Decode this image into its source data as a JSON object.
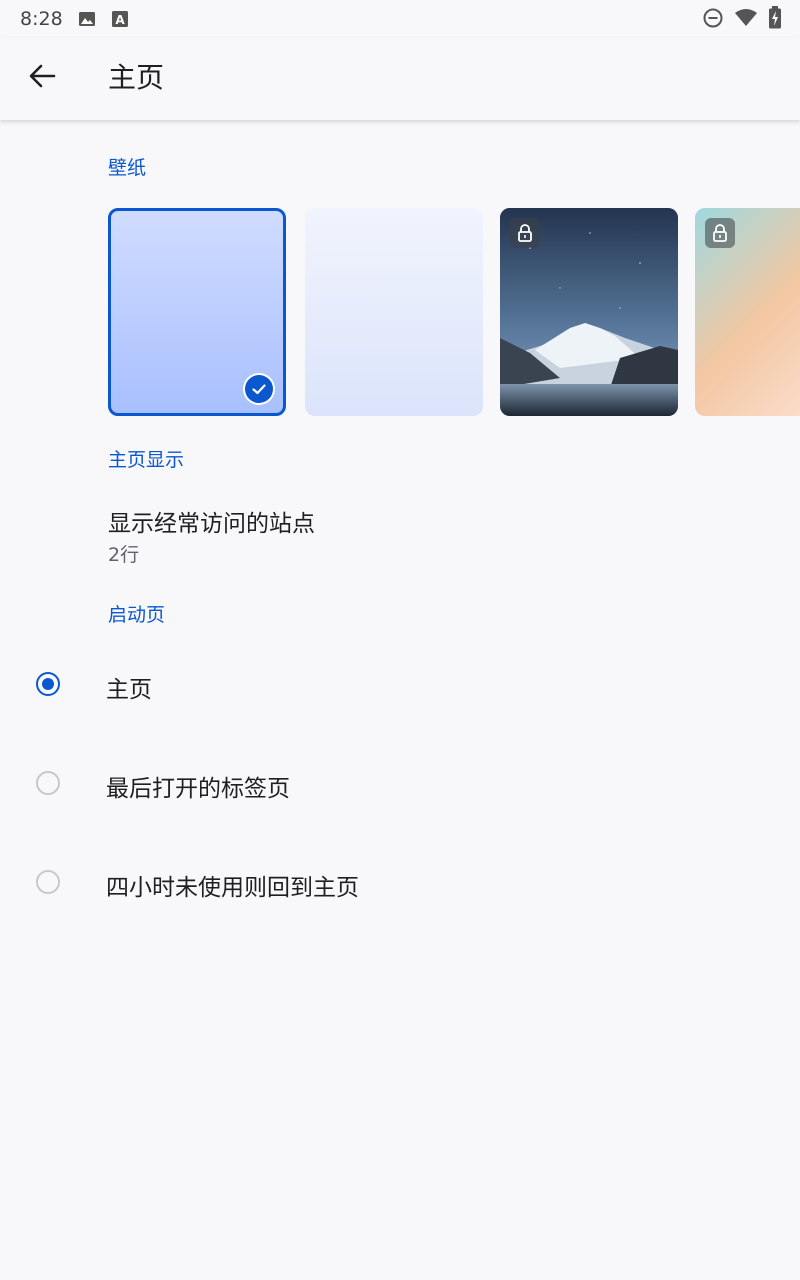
{
  "status_bar": {
    "time": "8:28",
    "icons": [
      "image-icon",
      "text-a-icon",
      "do-not-disturb-icon",
      "wifi-icon",
      "battery-charging-icon"
    ]
  },
  "app_bar": {
    "back_icon": "arrow-back-icon",
    "title": "主页"
  },
  "wallpaper": {
    "header": "壁纸",
    "items": [
      {
        "selected": true,
        "locked": false
      },
      {
        "selected": false,
        "locked": false
      },
      {
        "selected": false,
        "locked": true
      },
      {
        "selected": false,
        "locked": true
      }
    ]
  },
  "homepage_display": {
    "header": "主页显示",
    "item": {
      "title": "显示经常访问的站点",
      "summary": "2行"
    }
  },
  "startup": {
    "header": "启动页",
    "options": [
      {
        "label": "主页",
        "checked": true
      },
      {
        "label": "最后打开的标签页",
        "checked": false
      },
      {
        "label": "四小时未使用则回到主页",
        "checked": false
      }
    ]
  },
  "colors": {
    "accent": "#0b57d0",
    "background": "#f8f8fb"
  }
}
